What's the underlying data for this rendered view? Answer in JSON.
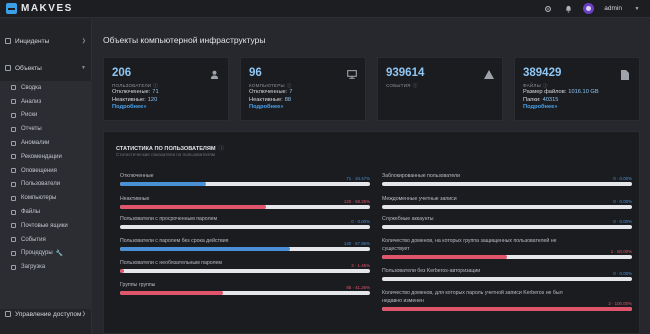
{
  "header": {
    "logo_text": "MAKVES",
    "user": "admin"
  },
  "colors": {
    "blue": "#4a90d6",
    "red": "#e0546c",
    "link": "#4aa3ef",
    "number": "#8fc6f3",
    "bg": "#26282d",
    "card": "#1b1c20"
  },
  "sidebar": {
    "incidents_label": "Инциденты",
    "objects_label": "Объекты",
    "items": [
      {
        "label": "Сводка",
        "icon": "summary-icon"
      },
      {
        "label": "Анализ",
        "icon": "analysis-icon"
      },
      {
        "label": "Риски",
        "icon": "risk-icon"
      },
      {
        "label": "Отчеты",
        "icon": "reports-icon"
      },
      {
        "label": "Аномалии",
        "icon": "anomaly-icon"
      },
      {
        "label": "Рекомендации",
        "icon": "recommend-icon"
      },
      {
        "label": "Оповещения",
        "icon": "alerts-icon"
      },
      {
        "label": "Пользователи",
        "icon": "users-icon"
      },
      {
        "label": "Компьютеры",
        "icon": "computers-icon"
      },
      {
        "label": "Файлы",
        "icon": "files-icon"
      },
      {
        "label": "Почтовые ящики",
        "icon": "mailbox-icon"
      },
      {
        "label": "События",
        "icon": "events-icon"
      },
      {
        "label": "Процедуры",
        "icon": "procedures-icon",
        "badge": "🔧"
      },
      {
        "label": "Загрузка",
        "icon": "upload-icon"
      }
    ],
    "access_label": "Управление доступом"
  },
  "page": {
    "title": "Объекты компьютерной инфраструктуры"
  },
  "cards": {
    "users": {
      "number": "206",
      "label": "ПОЛЬЗОВАТЕЛИ",
      "line1_label": "Отключенные:",
      "line1_value": "71",
      "line2_label": "Неактивные:",
      "line2_value": "120",
      "link": "Подробнее»",
      "icon": "user-icon"
    },
    "computers": {
      "number": "96",
      "label": "КОМПЬЮТЕРЫ",
      "line1_label": "Отключенные:",
      "line1_value": "7",
      "line2_label": "Неактивные:",
      "line2_value": "88",
      "link": "Подробнее»",
      "icon": "monitor-icon"
    },
    "events": {
      "number": "939614",
      "label": "СОБЫТИЯ",
      "icon": "warning-icon"
    },
    "files": {
      "number": "389429",
      "label": "ФАЙЛЫ",
      "line1_label": "Размер файлов:",
      "line1_value": "1016.10 GB",
      "line2_label": "Папки:",
      "line2_value": "40315",
      "link": "Подробнее»",
      "icon": "file-icon"
    }
  },
  "stats": {
    "title": "СТАТИСТИКА ПО ПОЛЬЗОВАТЕЛЯМ",
    "subtitle": "Статистические показатели по пользователям",
    "left": [
      {
        "label": "Отключенные",
        "value": "71 · 34.47%",
        "fraction": 0.3447,
        "color": "blue"
      },
      {
        "label": "Неактивные",
        "value": "120 · 58.25%",
        "fraction": 0.5825,
        "color": "red"
      },
      {
        "label": "Пользователи с просроченным паролем",
        "value": "0 · 0.00%",
        "fraction": 0.0,
        "color": "blue"
      },
      {
        "label": "Пользователи с паролем без срока действия",
        "value": "140 · 67.96%",
        "fraction": 0.6796,
        "color": "blue"
      },
      {
        "label": "Пользователи с необязательным паролем",
        "value": "3 · 1.46%",
        "fraction": 0.0146,
        "color": "red"
      },
      {
        "label": "Группы группы",
        "value": "85 · 41.26%",
        "fraction": 0.4126,
        "color": "red"
      }
    ],
    "right": [
      {
        "label": "Заблокированные пользователи",
        "value": "0 · 0.00%",
        "fraction": 0.0,
        "color": "blue"
      },
      {
        "label": "Междоменные учетные записи",
        "value": "0 · 0.00%",
        "fraction": 0.0,
        "color": "blue"
      },
      {
        "label": "Служебные аккаунты",
        "value": "0 · 0.00%",
        "fraction": 0.0,
        "color": "blue"
      },
      {
        "label": "Количество доменов, на которых группа защищенных пользователей не существует",
        "value": "1 · 50.00%",
        "fraction": 0.5,
        "color": "red"
      },
      {
        "label": "Пользователи без Kerberos-авторизации",
        "value": "0 · 0.00%",
        "fraction": 0.0,
        "color": "blue"
      },
      {
        "label": "Количество доменов, для которых пароль учетной записи Kerberos не был недавно изменен",
        "value": "2 · 100.00%",
        "fraction": 1.0,
        "color": "red"
      }
    ]
  }
}
